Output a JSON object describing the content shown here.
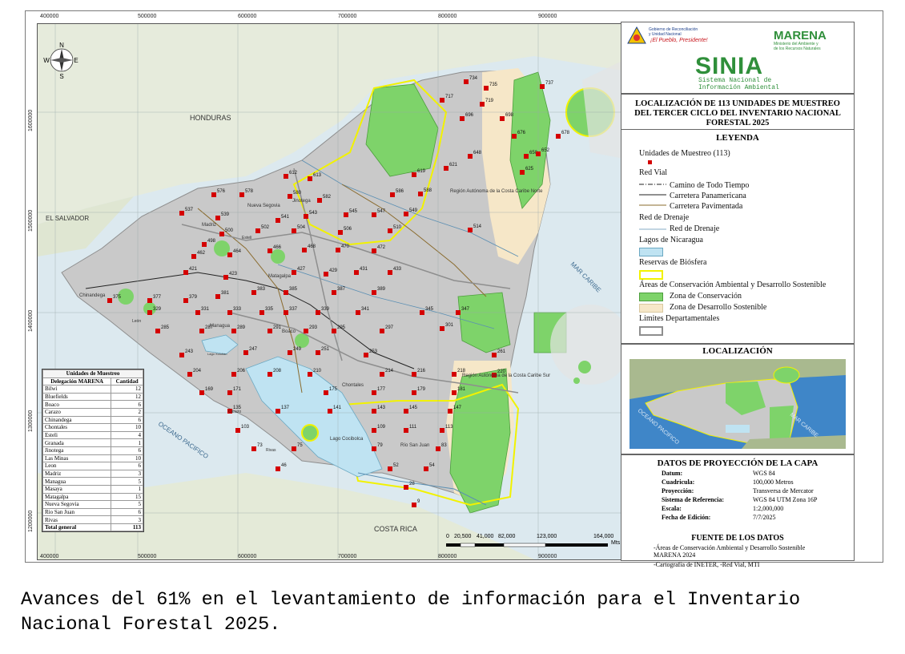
{
  "map": {
    "coords_top": [
      "400000",
      "500000",
      "600000",
      "700000",
      "800000",
      "900000"
    ],
    "coords_side": [
      "1600000",
      "1500000",
      "1400000",
      "1300000",
      "1200000"
    ],
    "country_labels": {
      "honduras": "HONDURAS",
      "el_salvador": "EL\nSALVADOR",
      "costa_rica": "COSTA RICA",
      "mar_caribe": "MAR CARIBE",
      "oceano_pacifico": "OCEANO PACIFICO",
      "lago_cocibolca": "Lago Cocibolca",
      "lago_xolotlan": "Lago Xolotlán",
      "raccn": "Región Autónoma\nde la Costa\nCaribe Norte",
      "raccs": "Región Autónoma\nde la Costa\nCaribe Sur",
      "nueva_segovia": "Nueva Segovia",
      "madriz": "Madriz",
      "jinotega": "Jinotega",
      "matagalpa": "Matagalpa",
      "boaco": "Boaco",
      "chontales": "Chontales",
      "rio_san_juan": "Río San Juan",
      "chinandega": "Chinandega",
      "managua": "Managua",
      "carazo": "Carazo",
      "rivas": "Rivas",
      "esteli": "Estelí",
      "leon": "León"
    },
    "sample_points": [
      {
        "id": "734"
      },
      {
        "id": "735"
      },
      {
        "id": "737"
      },
      {
        "id": "717"
      },
      {
        "id": "719"
      },
      {
        "id": "696"
      },
      {
        "id": "698"
      },
      {
        "id": "676"
      },
      {
        "id": "678"
      },
      {
        "id": "650"
      },
      {
        "id": "652"
      },
      {
        "id": "648"
      },
      {
        "id": "625"
      },
      {
        "id": "621"
      },
      {
        "id": "619"
      },
      {
        "id": "612"
      },
      {
        "id": "613"
      },
      {
        "id": "576"
      },
      {
        "id": "578"
      },
      {
        "id": "580"
      },
      {
        "id": "582"
      },
      {
        "id": "586"
      },
      {
        "id": "588"
      },
      {
        "id": "537"
      },
      {
        "id": "539"
      },
      {
        "id": "541"
      },
      {
        "id": "543"
      },
      {
        "id": "545"
      },
      {
        "id": "547"
      },
      {
        "id": "549"
      },
      {
        "id": "514"
      },
      {
        "id": "510"
      },
      {
        "id": "506"
      },
      {
        "id": "504"
      },
      {
        "id": "502"
      },
      {
        "id": "500"
      },
      {
        "id": "498"
      },
      {
        "id": "470"
      },
      {
        "id": "472"
      },
      {
        "id": "468"
      },
      {
        "id": "466"
      },
      {
        "id": "464"
      },
      {
        "id": "462"
      },
      {
        "id": "433"
      },
      {
        "id": "431"
      },
      {
        "id": "429"
      },
      {
        "id": "427"
      },
      {
        "id": "423"
      },
      {
        "id": "421"
      },
      {
        "id": "389"
      },
      {
        "id": "387"
      },
      {
        "id": "385"
      },
      {
        "id": "383"
      },
      {
        "id": "381"
      },
      {
        "id": "379"
      },
      {
        "id": "377"
      },
      {
        "id": "375"
      },
      {
        "id": "347"
      },
      {
        "id": "345"
      },
      {
        "id": "341"
      },
      {
        "id": "339"
      },
      {
        "id": "337"
      },
      {
        "id": "335"
      },
      {
        "id": "333"
      },
      {
        "id": "331"
      },
      {
        "id": "329"
      },
      {
        "id": "301"
      },
      {
        "id": "297"
      },
      {
        "id": "295"
      },
      {
        "id": "293"
      },
      {
        "id": "291"
      },
      {
        "id": "289"
      },
      {
        "id": "287"
      },
      {
        "id": "285"
      },
      {
        "id": "261"
      },
      {
        "id": "253"
      },
      {
        "id": "251"
      },
      {
        "id": "249"
      },
      {
        "id": "247"
      },
      {
        "id": "243"
      },
      {
        "id": "220"
      },
      {
        "id": "218"
      },
      {
        "id": "216"
      },
      {
        "id": "214"
      },
      {
        "id": "210"
      },
      {
        "id": "208"
      },
      {
        "id": "206"
      },
      {
        "id": "204"
      },
      {
        "id": "181"
      },
      {
        "id": "179"
      },
      {
        "id": "177"
      },
      {
        "id": "175"
      },
      {
        "id": "171"
      },
      {
        "id": "169"
      },
      {
        "id": "147"
      },
      {
        "id": "145"
      },
      {
        "id": "143"
      },
      {
        "id": "141"
      },
      {
        "id": "137"
      },
      {
        "id": "135"
      },
      {
        "id": "113"
      },
      {
        "id": "111"
      },
      {
        "id": "109"
      },
      {
        "id": "103"
      },
      {
        "id": "83"
      },
      {
        "id": "79"
      },
      {
        "id": "75"
      },
      {
        "id": "73"
      },
      {
        "id": "54"
      },
      {
        "id": "52"
      },
      {
        "id": "46"
      },
      {
        "id": "28"
      },
      {
        "id": "9"
      }
    ],
    "scale_labels": [
      "0",
      "20,500",
      "41,000",
      "82,000",
      "123,000",
      "164,000",
      "Mts"
    ],
    "compass": {
      "n": "N",
      "s": "S",
      "e": "E",
      "w": "W"
    }
  },
  "table": {
    "title": "Unidades de Muestreo",
    "headers": [
      "Delegación MARENA",
      "Cantidad"
    ],
    "rows": [
      [
        "Bilwi",
        "12"
      ],
      [
        "Bluefields",
        "12"
      ],
      [
        "Boaco",
        "6"
      ],
      [
        "Carazo",
        "2"
      ],
      [
        "Chinandega",
        "6"
      ],
      [
        "Chontales",
        "10"
      ],
      [
        "Esteli",
        "4"
      ],
      [
        "Granada",
        "1"
      ],
      [
        "Jinotega",
        "6"
      ],
      [
        "Las Minas",
        "10"
      ],
      [
        "Leon",
        "6"
      ],
      [
        "Madriz",
        "3"
      ],
      [
        "Managua",
        "5"
      ],
      [
        "Masaya",
        "1"
      ],
      [
        "Matagalpa",
        "15"
      ],
      [
        "Nueva Segovia",
        "5"
      ],
      [
        "Rio San Juan",
        "6"
      ],
      [
        "Rivas",
        "3"
      ]
    ],
    "total": [
      "Total general",
      "113"
    ]
  },
  "header": {
    "gov_line1": "Gobierno de Reconciliación",
    "gov_line2": "y Unidad Nacional",
    "gov_slogan": "¡El Pueblo, Presidente!",
    "marena": "MARENA",
    "marena_sub1": "Ministerio del Ambiente y",
    "marena_sub2": "de los Recursos Naturales",
    "sinia": "SINIA",
    "sinia_sub1": "Sistema Nacional de",
    "sinia_sub2": "Información Ambiental"
  },
  "title": "LOCALIZACIÓN DE 113 UNIDADES DE MUESTREO DEL TERCER CICLO DEL INVENTARIO NACIONAL FORESTAL 2025",
  "legend": {
    "head": "LEYENDA",
    "units": "Unidades de Muestreo (113)",
    "red_vial": "Red Vial",
    "camino": "Camino de Todo Tiempo",
    "panamericana": "Carretera Panamericana",
    "pavimentada": "Carretera Pavimentada",
    "red_drenaje_group": "Red de Drenaje",
    "red_drenaje": "Red de Drenaje",
    "lagos": "Lagos de Nicaragua",
    "reservas": "Reservas de Biósfera",
    "areas": "Áreas de Conservación Ambiental y Desarrollo Sostenible",
    "zona_conservacion": "Zona de Conservación",
    "zona_desarrollo": "Zona de Desarrollo Sostenible",
    "limites": "Limites Departamentales"
  },
  "localizacion": {
    "head": "LOCALIZACIÓN",
    "mar_caribe": "MAR CARIBE",
    "oceano_pacifico": "OCEANO PACIFICO"
  },
  "projection": {
    "head": "DATOS DE PROYECCIÓN DE LA CAPA",
    "rows": [
      [
        "Datum:",
        "WGS 84"
      ],
      [
        "Cuadricula:",
        "100,000 Metros"
      ],
      [
        "Proyección:",
        "Transversa de Mercator"
      ],
      [
        "Sistema de Referencia:",
        "WGS 84 UTM Zona 16P"
      ],
      [
        "Escala:",
        "1:2,000,000"
      ],
      [
        "Fecha de Edición:",
        "7/7/2025"
      ]
    ],
    "fuente_head": "FUENTE DE LOS DATOS",
    "fuente_1": "-Áreas de Conservación Ambiental y Desarrollo Sostenible",
    "fuente_2": "MARENA 2024",
    "fuente_3": "-Cartografía de INETER,  -Red Vial, MTI"
  },
  "caption": "Avances del 61% en el levantamiento de información para el Inventario Nacional Forestal 2025.",
  "colors": {
    "sample_point": "#d40000",
    "conservation": "#7ed36a",
    "development": "#f6e7c8",
    "biosphere": "#f2f200",
    "lake": "#bfe3f2",
    "sea": "#dce9ef",
    "land_base": "#c9c9c9"
  }
}
